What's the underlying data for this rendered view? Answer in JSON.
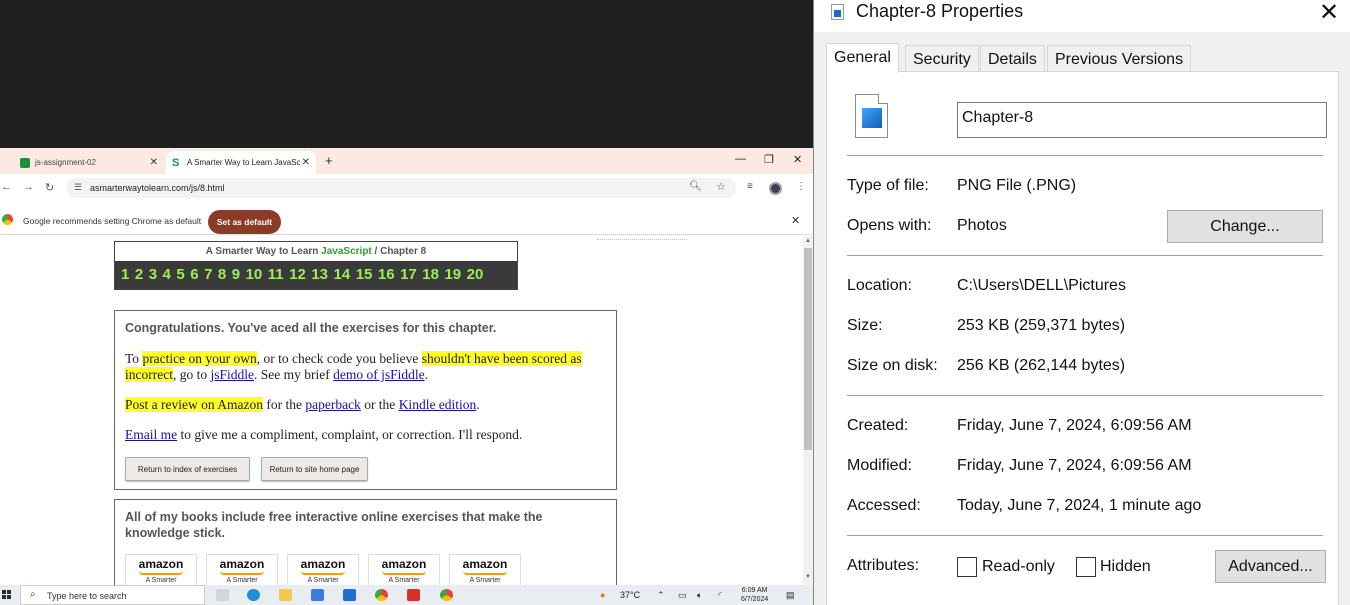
{
  "browser": {
    "tabs": [
      {
        "label": "js-assignment-02"
      },
      {
        "label": "A Smarter Way to Learn JavaSc"
      }
    ],
    "url": "asmarterwaytolearn.com/js/8.html",
    "infobar": {
      "message": "Google recommends setting Chrome as default",
      "button": "Set as default"
    }
  },
  "page": {
    "chapter_nav": {
      "title_prefix": "A Smarter Way to Learn",
      "title_js": "JavaScript",
      "title_suffix": "/  Chapter 8",
      "numbers": [
        "1",
        "2",
        "3",
        "4",
        "5",
        "6",
        "7",
        "8",
        "9",
        "10",
        "11",
        "12",
        "13",
        "14",
        "15",
        "16",
        "17",
        "18",
        "19",
        "20"
      ]
    },
    "congrats": {
      "heading": "Congratulations. You've aced all the exercises for this chapter.",
      "p1": {
        "t1": "To ",
        "h1": "practice on your own",
        "t2": ", or to check code you believe ",
        "h2": "shouldn't have been scored as incorrect",
        "t3": ", go to ",
        "link1": "jsFiddle",
        "t4": ". See my brief ",
        "link2": "demo of jsFiddle",
        "t5": "."
      },
      "p2": {
        "h1": "Post a review on Amazon",
        "t1": " for the ",
        "link1": "paperback",
        "t2": " or the ",
        "link2": "Kindle edition",
        "t3": "."
      },
      "p3": {
        "link1": "Email me",
        "t1": " to give me a compliment, complaint, or correction. I'll respond."
      },
      "buttons": {
        "index": "Return to index of exercises",
        "home": "Return to site home page"
      }
    },
    "books": {
      "heading": "All of my books include free interactive online exercises that make the knowledge stick.",
      "items": [
        {
          "brand": "amazon",
          "cover": "A Smarter"
        },
        {
          "brand": "amazon",
          "cover": "A Smarter"
        },
        {
          "brand": "amazon",
          "cover": "A Smarter"
        },
        {
          "brand": "amazon",
          "cover": "A Smarter"
        },
        {
          "brand": "amazon",
          "cover": "A Smarter"
        }
      ]
    }
  },
  "taskbar": {
    "search_placeholder": "Type here to search",
    "weather": "37°C",
    "time": "6:09 AM",
    "date": "6/7/2024"
  },
  "dialog": {
    "title": "Chapter-8 Properties",
    "tabs": [
      "General",
      "Security",
      "Details",
      "Previous Versions"
    ],
    "file_name": "Chapter-8",
    "type_label": "Type of file:",
    "type_value": "PNG File (.PNG)",
    "opens_label": "Opens with:",
    "opens_value": "Photos",
    "change_button": "Change...",
    "location_label": "Location:",
    "location_value": "C:\\Users\\DELL\\Pictures",
    "size_label": "Size:",
    "size_value": "253 KB (259,371 bytes)",
    "size_disk_label": "Size on disk:",
    "size_disk_value": "256 KB (262,144 bytes)",
    "created_label": "Created:",
    "created_value": "Friday, June 7, 2024, 6:09:56 AM",
    "modified_label": "Modified:",
    "modified_value": "Friday, June 7, 2024, 6:09:56 AM",
    "accessed_label": "Accessed:",
    "accessed_value": "Today, June 7, 2024, 1 minute ago",
    "attributes_label": "Attributes:",
    "readonly_label": "Read-only",
    "hidden_label": "Hidden",
    "advanced_button": "Advanced..."
  }
}
